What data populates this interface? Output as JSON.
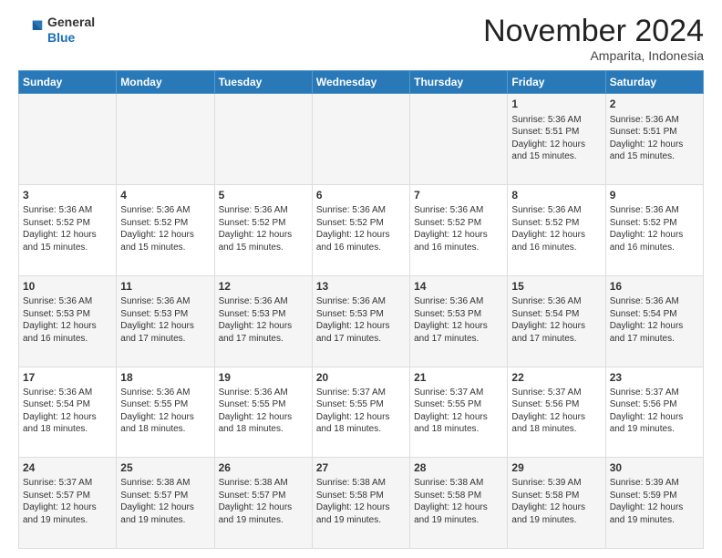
{
  "logo": {
    "general": "General",
    "blue": "Blue"
  },
  "header": {
    "month": "November 2024",
    "location": "Amparita, Indonesia"
  },
  "weekdays": [
    "Sunday",
    "Monday",
    "Tuesday",
    "Wednesday",
    "Thursday",
    "Friday",
    "Saturday"
  ],
  "weeks": [
    [
      {
        "day": "",
        "content": ""
      },
      {
        "day": "",
        "content": ""
      },
      {
        "day": "",
        "content": ""
      },
      {
        "day": "",
        "content": ""
      },
      {
        "day": "",
        "content": ""
      },
      {
        "day": "1",
        "content": "Sunrise: 5:36 AM\nSunset: 5:51 PM\nDaylight: 12 hours and 15 minutes."
      },
      {
        "day": "2",
        "content": "Sunrise: 5:36 AM\nSunset: 5:51 PM\nDaylight: 12 hours and 15 minutes."
      }
    ],
    [
      {
        "day": "3",
        "content": "Sunrise: 5:36 AM\nSunset: 5:52 PM\nDaylight: 12 hours and 15 minutes."
      },
      {
        "day": "4",
        "content": "Sunrise: 5:36 AM\nSunset: 5:52 PM\nDaylight: 12 hours and 15 minutes."
      },
      {
        "day": "5",
        "content": "Sunrise: 5:36 AM\nSunset: 5:52 PM\nDaylight: 12 hours and 15 minutes."
      },
      {
        "day": "6",
        "content": "Sunrise: 5:36 AM\nSunset: 5:52 PM\nDaylight: 12 hours and 16 minutes."
      },
      {
        "day": "7",
        "content": "Sunrise: 5:36 AM\nSunset: 5:52 PM\nDaylight: 12 hours and 16 minutes."
      },
      {
        "day": "8",
        "content": "Sunrise: 5:36 AM\nSunset: 5:52 PM\nDaylight: 12 hours and 16 minutes."
      },
      {
        "day": "9",
        "content": "Sunrise: 5:36 AM\nSunset: 5:52 PM\nDaylight: 12 hours and 16 minutes."
      }
    ],
    [
      {
        "day": "10",
        "content": "Sunrise: 5:36 AM\nSunset: 5:53 PM\nDaylight: 12 hours and 16 minutes."
      },
      {
        "day": "11",
        "content": "Sunrise: 5:36 AM\nSunset: 5:53 PM\nDaylight: 12 hours and 17 minutes."
      },
      {
        "day": "12",
        "content": "Sunrise: 5:36 AM\nSunset: 5:53 PM\nDaylight: 12 hours and 17 minutes."
      },
      {
        "day": "13",
        "content": "Sunrise: 5:36 AM\nSunset: 5:53 PM\nDaylight: 12 hours and 17 minutes."
      },
      {
        "day": "14",
        "content": "Sunrise: 5:36 AM\nSunset: 5:53 PM\nDaylight: 12 hours and 17 minutes."
      },
      {
        "day": "15",
        "content": "Sunrise: 5:36 AM\nSunset: 5:54 PM\nDaylight: 12 hours and 17 minutes."
      },
      {
        "day": "16",
        "content": "Sunrise: 5:36 AM\nSunset: 5:54 PM\nDaylight: 12 hours and 17 minutes."
      }
    ],
    [
      {
        "day": "17",
        "content": "Sunrise: 5:36 AM\nSunset: 5:54 PM\nDaylight: 12 hours and 18 minutes."
      },
      {
        "day": "18",
        "content": "Sunrise: 5:36 AM\nSunset: 5:55 PM\nDaylight: 12 hours and 18 minutes."
      },
      {
        "day": "19",
        "content": "Sunrise: 5:36 AM\nSunset: 5:55 PM\nDaylight: 12 hours and 18 minutes."
      },
      {
        "day": "20",
        "content": "Sunrise: 5:37 AM\nSunset: 5:55 PM\nDaylight: 12 hours and 18 minutes."
      },
      {
        "day": "21",
        "content": "Sunrise: 5:37 AM\nSunset: 5:55 PM\nDaylight: 12 hours and 18 minutes."
      },
      {
        "day": "22",
        "content": "Sunrise: 5:37 AM\nSunset: 5:56 PM\nDaylight: 12 hours and 18 minutes."
      },
      {
        "day": "23",
        "content": "Sunrise: 5:37 AM\nSunset: 5:56 PM\nDaylight: 12 hours and 19 minutes."
      }
    ],
    [
      {
        "day": "24",
        "content": "Sunrise: 5:37 AM\nSunset: 5:57 PM\nDaylight: 12 hours and 19 minutes."
      },
      {
        "day": "25",
        "content": "Sunrise: 5:38 AM\nSunset: 5:57 PM\nDaylight: 12 hours and 19 minutes."
      },
      {
        "day": "26",
        "content": "Sunrise: 5:38 AM\nSunset: 5:57 PM\nDaylight: 12 hours and 19 minutes."
      },
      {
        "day": "27",
        "content": "Sunrise: 5:38 AM\nSunset: 5:58 PM\nDaylight: 12 hours and 19 minutes."
      },
      {
        "day": "28",
        "content": "Sunrise: 5:38 AM\nSunset: 5:58 PM\nDaylight: 12 hours and 19 minutes."
      },
      {
        "day": "29",
        "content": "Sunrise: 5:39 AM\nSunset: 5:58 PM\nDaylight: 12 hours and 19 minutes."
      },
      {
        "day": "30",
        "content": "Sunrise: 5:39 AM\nSunset: 5:59 PM\nDaylight: 12 hours and 19 minutes."
      }
    ]
  ]
}
